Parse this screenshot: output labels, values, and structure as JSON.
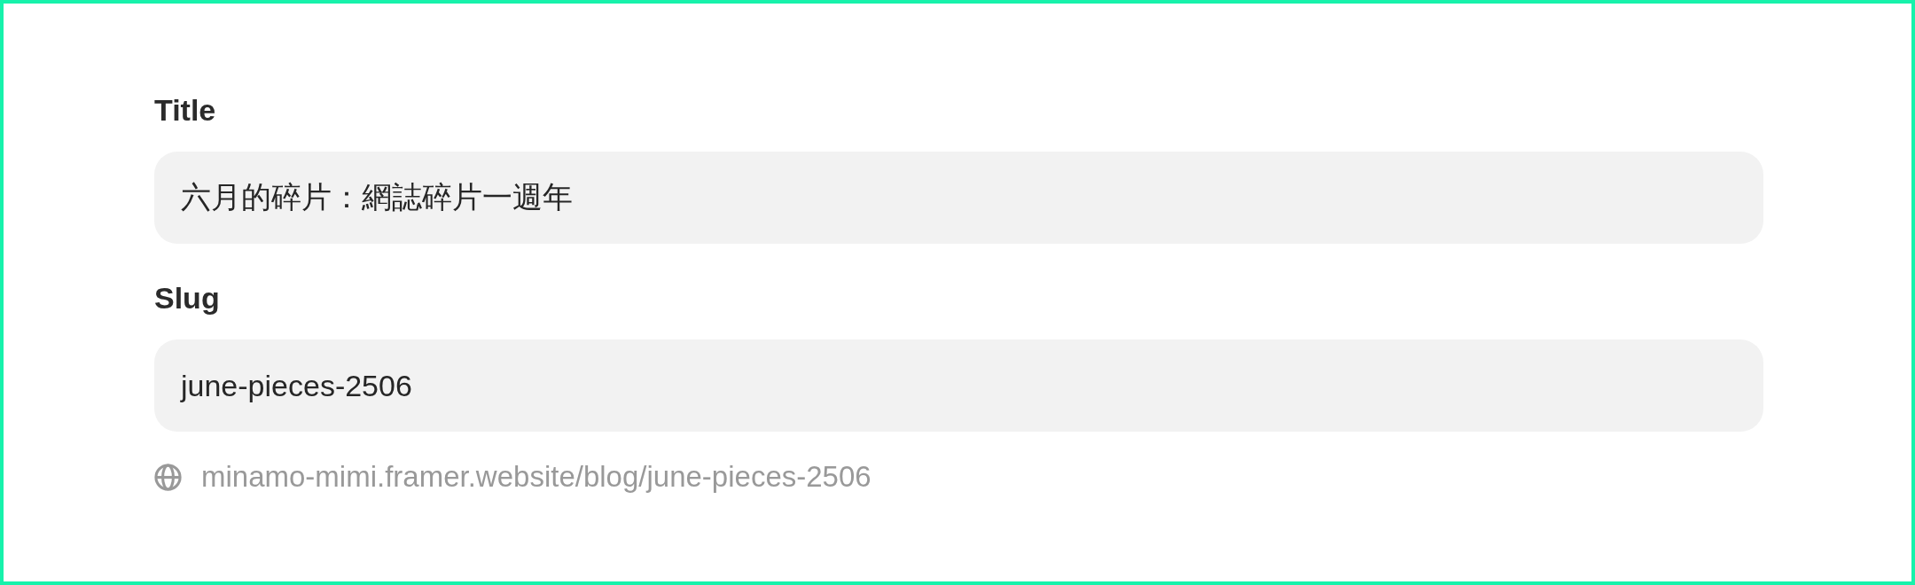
{
  "fields": [
    {
      "label": "Title",
      "value": "六月的碎片：網誌碎片一週年"
    },
    {
      "label": "Slug",
      "value": "june-pieces-2506"
    }
  ],
  "url_preview": {
    "text": "minamo-mimi.framer.website/blog/june-pieces-2506"
  }
}
